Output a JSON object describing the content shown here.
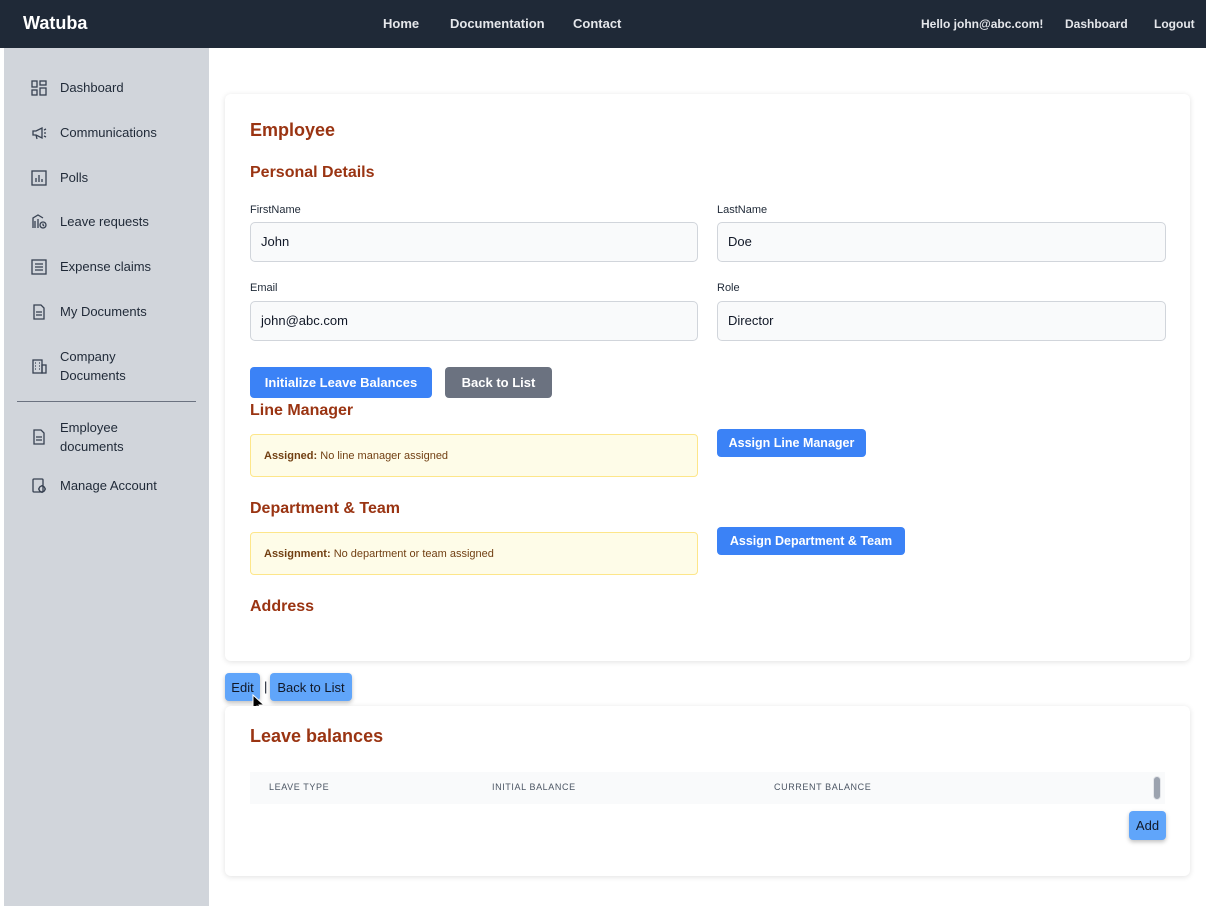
{
  "header": {
    "brand": "Watuba",
    "nav": [
      "Home",
      "Documentation",
      "Contact"
    ],
    "greeting": "Hello john@abc.com!",
    "dashboard": "Dashboard",
    "logout": "Logout"
  },
  "sidebar": {
    "items": [
      {
        "label": "Dashboard",
        "icon": "dashboard-icon"
      },
      {
        "label": "Communications",
        "icon": "megaphone-icon"
      },
      {
        "label": "Polls",
        "icon": "chart-icon"
      },
      {
        "label": "Leave requests",
        "icon": "leave-icon"
      },
      {
        "label": "Expense claims",
        "icon": "list-icon"
      },
      {
        "label": "My Documents",
        "icon": "document-icon"
      },
      {
        "label": "Company Documents",
        "icon": "building-icon"
      },
      {
        "label": "Employee documents",
        "icon": "document-icon"
      },
      {
        "label": "Manage Account",
        "icon": "gear-icon"
      }
    ]
  },
  "employee": {
    "title": "Employee",
    "personal_heading": "Personal Details",
    "firstname_label": "FirstName",
    "firstname_value": "John",
    "lastname_label": "LastName",
    "lastname_value": "Doe",
    "email_label": "Email",
    "email_value": "john@abc.com",
    "role_label": "Role",
    "role_value": "Director",
    "init_button": "Initialize Leave Balances",
    "back_button": "Back to List",
    "line_manager_heading": "Line Manager",
    "line_manager_key": "Assigned:",
    "line_manager_value": "No line manager assigned",
    "assign_line_manager": "Assign Line Manager",
    "dept_heading": "Department & Team",
    "dept_key": "Assignment:",
    "dept_value": "No department or team assigned",
    "assign_dept": "Assign Department & Team",
    "address_heading": "Address"
  },
  "actions": {
    "edit": "Edit",
    "separator": "|",
    "back": "Back to List"
  },
  "leave": {
    "title": "Leave balances",
    "columns": [
      "LEAVE TYPE",
      "INITIAL BALANCE",
      "CURRENT BALANCE"
    ],
    "rows": [],
    "add": "Add"
  },
  "colors": {
    "topbar": "#1f2937",
    "sidebar": "#d1d5db",
    "heading": "#9a3412",
    "primary": "#3b82f6",
    "secondary": "#6b7280"
  }
}
